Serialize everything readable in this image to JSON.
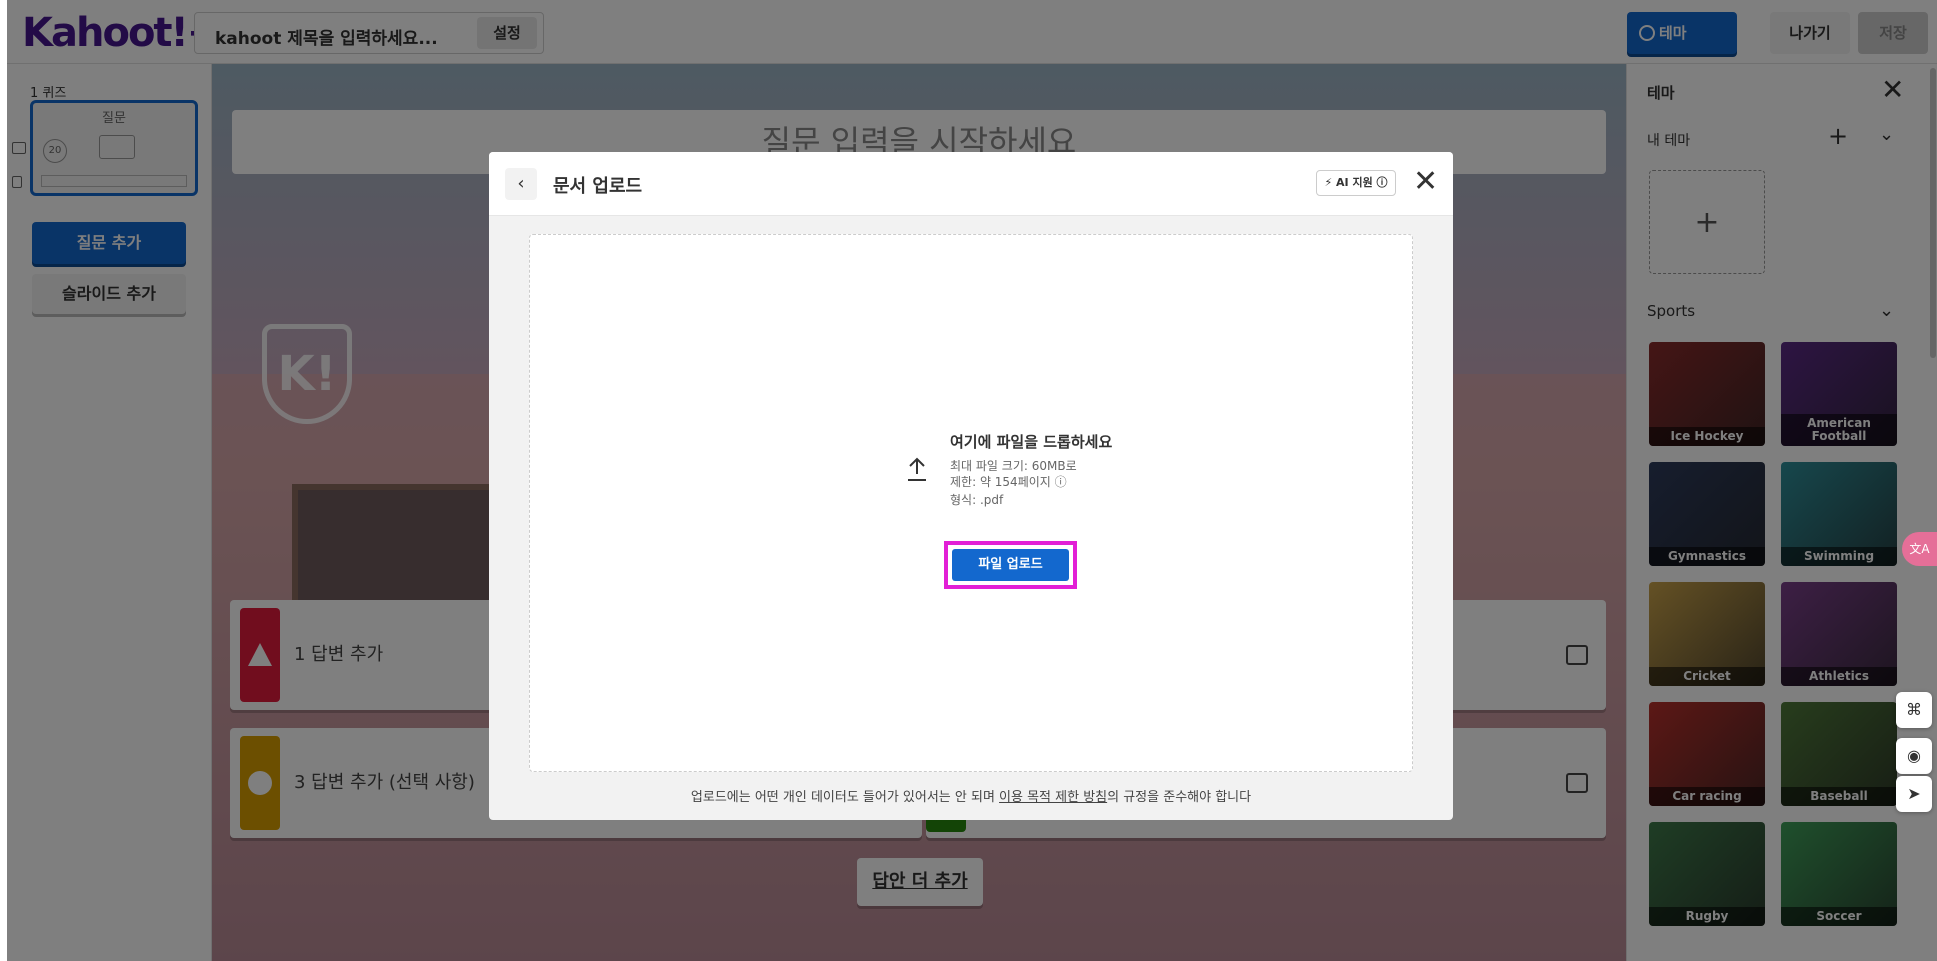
{
  "app": {
    "logo": "Kahoot!+",
    "title_placeholder": "kahoot 제목을 입력하세요...",
    "settings_label": "설정",
    "theme_label": "테마",
    "exit_label": "나가기",
    "save_label": "저장"
  },
  "sidebar": {
    "quiz_label": "1 퀴즈",
    "thumb_label": "질문",
    "thumb_timer": "20",
    "add_question": "질문 추가",
    "add_slide": "슬라이드 추가"
  },
  "editor": {
    "question_placeholder": "질문 입력을 시작하세요",
    "answers": [
      {
        "label": "1 답변 추가",
        "color": "#e21b3c"
      },
      {
        "label": "3 답변 추가 (선택 사항)",
        "color": "#d89e00"
      }
    ],
    "more_answers": "답안 더 추가",
    "shield_text": "K!"
  },
  "theme_panel": {
    "title": "테마",
    "my_themes": "내 테마",
    "sports_section": "Sports",
    "tiles": [
      {
        "name": "Ice Hockey",
        "color": "#8a2b2b"
      },
      {
        "name": "American Football",
        "color": "#5b2a86"
      },
      {
        "name": "Gymnastics",
        "color": "#2d3b5c"
      },
      {
        "name": "Swimming",
        "color": "#2e8f9a"
      },
      {
        "name": "Cricket",
        "color": "#c9a24a"
      },
      {
        "name": "Athletics",
        "color": "#7a3f8a"
      },
      {
        "name": "Car racing",
        "color": "#b8302b"
      },
      {
        "name": "Baseball",
        "color": "#4f7a3a"
      },
      {
        "name": "Rugby",
        "color": "#3e7a4a"
      },
      {
        "name": "Soccer",
        "color": "#3fa05a"
      }
    ]
  },
  "modal": {
    "title": "문서 업로드",
    "ai_badge": "⚡ AI 지원 ⓘ",
    "drop_title": "여기에 파일을 드롭하세요",
    "max_size": "최대 파일 크기: 60MB로",
    "limit": "제한: 약 154페이지 ⓘ",
    "format": "형식: .pdf",
    "upload_button": "파일 업로드",
    "footer_prefix": "업로드에는 어떤 개인 데이터도 들어가 있어서는 안 되며 ",
    "footer_link": "이용 목적 제한 방침",
    "footer_suffix": "의 규정을 준수해야 합니다"
  },
  "colors": {
    "brand": "#46178f",
    "primary": "#1368ce",
    "highlight": "#e21fd6"
  }
}
